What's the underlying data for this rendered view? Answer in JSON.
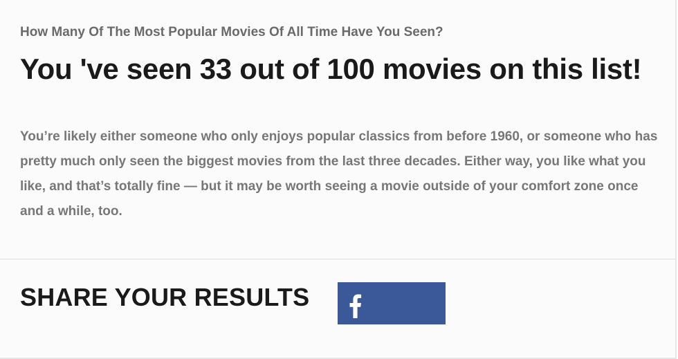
{
  "quiz": {
    "title": "How Many Of The Most Popular Movies Of All Time Have You Seen?"
  },
  "result": {
    "heading": "You 've seen 33 out of 100 movies on this list!",
    "description": "You’re likely either someone who only enjoys popular classics from before 1960, or someone who has pretty much only seen the biggest movies from the last three decades. Either way, you like what you like, and that’s totally fine — but it may be worth seeing a movie outside of your comfort zone once and a while, too."
  },
  "share": {
    "heading": "SHARE YOUR RESULTS",
    "facebook": {
      "icon": "facebook-icon",
      "color": "#3b5998"
    }
  }
}
